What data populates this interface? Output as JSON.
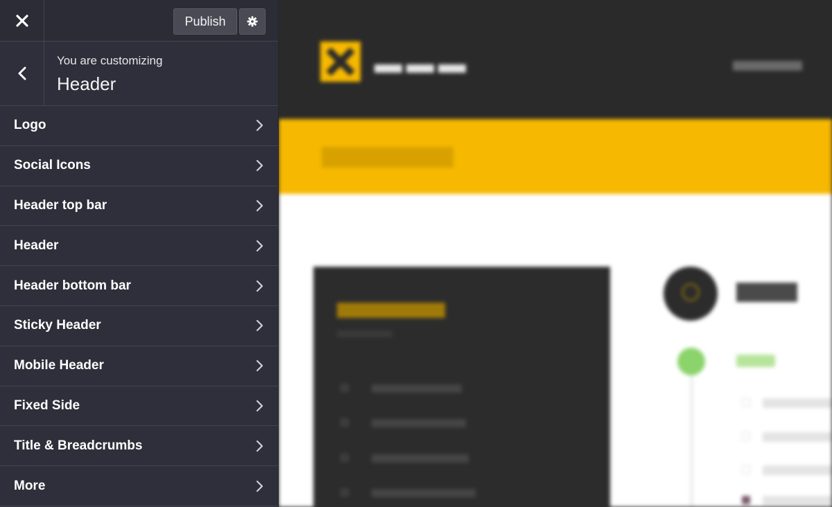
{
  "toolbar": {
    "publish_label": "Publish",
    "close_icon": "close-icon",
    "settings_icon": "gear-icon"
  },
  "breadcrumb": {
    "subtitle": "You are customizing",
    "title": "Header",
    "back_icon": "chevron-left-icon"
  },
  "menu": {
    "items": [
      {
        "label": "Logo"
      },
      {
        "label": "Social Icons"
      },
      {
        "label": "Header top bar"
      },
      {
        "label": "Header"
      },
      {
        "label": "Header bottom bar"
      },
      {
        "label": "Sticky Header"
      },
      {
        "label": "Mobile Header"
      },
      {
        "label": "Fixed Side"
      },
      {
        "label": "Title & Breadcrumbs"
      },
      {
        "label": "More"
      }
    ]
  },
  "colors": {
    "sidebar_bg": "#2f2f3b",
    "preview_header_bg": "#2a2a2a",
    "preview_accent": "#f6b800",
    "preview_success": "#8bd36b"
  }
}
